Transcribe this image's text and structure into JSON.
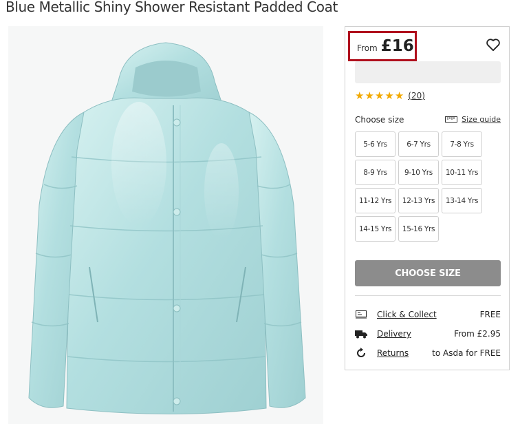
{
  "product": {
    "title": "Blue Metallic Shiny Shower Resistant Padded Coat",
    "image_icon": "puffer-jacket-image"
  },
  "price": {
    "prefix": "From",
    "value": "£16"
  },
  "wishlist_icon": "heart-outline-icon",
  "rating": {
    "stars": 5,
    "count": "(20)"
  },
  "sizes": {
    "label": "Choose size",
    "guide_label": "Size guide",
    "options": [
      "5-6 Yrs",
      "6-7 Yrs",
      "7-8 Yrs",
      "8-9 Yrs",
      "9-10 Yrs",
      "10-11 Yrs",
      "11-12 Yrs",
      "12-13 Yrs",
      "13-14 Yrs",
      "14-15 Yrs",
      "15-16 Yrs"
    ]
  },
  "cta": {
    "label": "CHOOSE SIZE"
  },
  "fulfilment": [
    {
      "icon": "click-collect-icon",
      "label": "Click & Collect",
      "value": "FREE"
    },
    {
      "icon": "delivery-truck-icon",
      "label": "Delivery",
      "value": "From £2.95"
    },
    {
      "icon": "returns-icon",
      "label": "Returns",
      "value": "to Asda for FREE"
    }
  ],
  "colors": {
    "price_highlight": "#b0101d",
    "star": "#f2a900",
    "cta_bg": "#8c8c8c",
    "jacket": "#bfe6e6"
  }
}
